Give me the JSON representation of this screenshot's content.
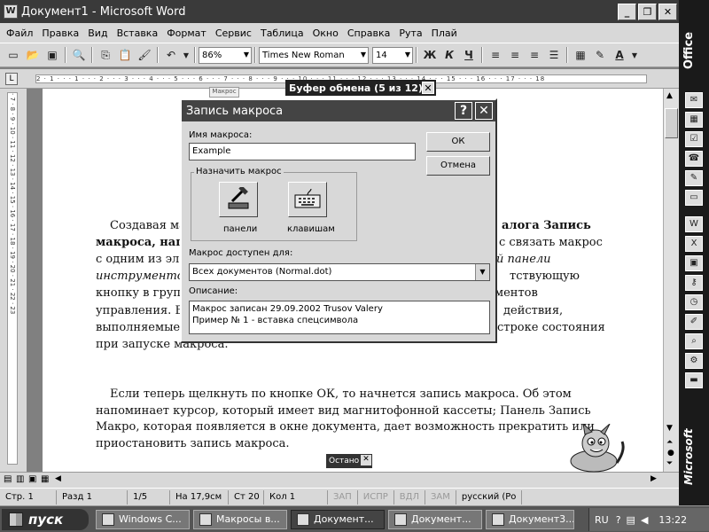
{
  "window": {
    "title": "Документ1 - Microsoft Word",
    "icon_letter": "W"
  },
  "menu": [
    "Файл",
    "Правка",
    "Вид",
    "Вставка",
    "Формат",
    "Сервис",
    "Таблица",
    "Окно",
    "Справка",
    "Рута",
    "Плай"
  ],
  "toolbar": {
    "zoom": "86%",
    "font": "Times New Roman",
    "size": "14",
    "bold": "Ж",
    "italic": "К",
    "underline": "Ч",
    "font_color_letter": "А"
  },
  "ruler": {
    "horizontal_ticks": "2 · 1 · · · 1 · · · 2 · · · 3 · · · 4 · · · 5 · · · 6 · · · 7 · · · 8 · · · 9 · · · 10 · · · 11 · · · 12 · · · 13 · · · 14 · · · 15 · · · 16 · · · 17 · · · 18",
    "vertical_ticks": "· 7 · 8 · 9 · 10 · 11 · 12 · 13 · 14 · 15 · 16 · 17 · 18 · 19 · 20 · 21 · 22 · 23"
  },
  "document": {
    "p1_lines": [
      "Создавая ма",
      "алога Запись",
      "макроса, нап",
      "с связать макрос",
      "с одним из эл",
      "й панели",
      "инструменто",
      "тствующую",
      "кнопку в груп",
      "ментов",
      "управления. В",
      "действия,",
      "выполняемые",
      "строке состояния",
      "при запуске макроса."
    ],
    "p2_lines": [
      "Если теперь щелкнуть по кнопке ОК, то начнется запись макроса. Об этом",
      "напоминает курсор, который имеет вид магнитофонной кассеты; Панель Запись",
      "Макро, которая появляется в окне документа, дает возможность прекратить или",
      "приостановить запись макроса."
    ]
  },
  "clipboard_toolbar": {
    "title": "Буфер обмена (5 из 12)"
  },
  "macro_button_label": "Макрос",
  "dialog": {
    "title": "Запись макроса",
    "name_label": "Имя макроса:",
    "name_value": "Example",
    "ok": "ОК",
    "cancel": "Отмена",
    "assign_group": "Назначить макрос",
    "toolbar_btn": "панели",
    "keyboard_btn": "клавишам",
    "store_label": "Макрос доступен для:",
    "store_value": "Всех документов (Normal.dot)",
    "desc_label": "Описание:",
    "desc_line1": "Макрос записан 29.09.2002 Trusov Valery",
    "desc_line2": "Пример № 1 - вставка спецсимвола"
  },
  "stop_toolbar": {
    "title": "Остано"
  },
  "status": {
    "page": "Стр. 1",
    "section": "Разд 1",
    "pages": "1/5",
    "at": "На 17,9см",
    "line": "Ст 20",
    "col": "Кол 1",
    "rec": "ЗАП",
    "trk": "ИСПР",
    "ext": "ВДЛ",
    "ovr": "ЗАМ",
    "lang": "русский (Ро"
  },
  "taskbar": {
    "start": "пуск",
    "tasks": [
      "Windows C...",
      "Макросы в...",
      "Документ...",
      "Документ...",
      "Документ3..."
    ],
    "lang": "RU",
    "clock": "13:22"
  },
  "office_bar": {
    "top_label": "Office",
    "bottom_label": "Microsoft"
  }
}
